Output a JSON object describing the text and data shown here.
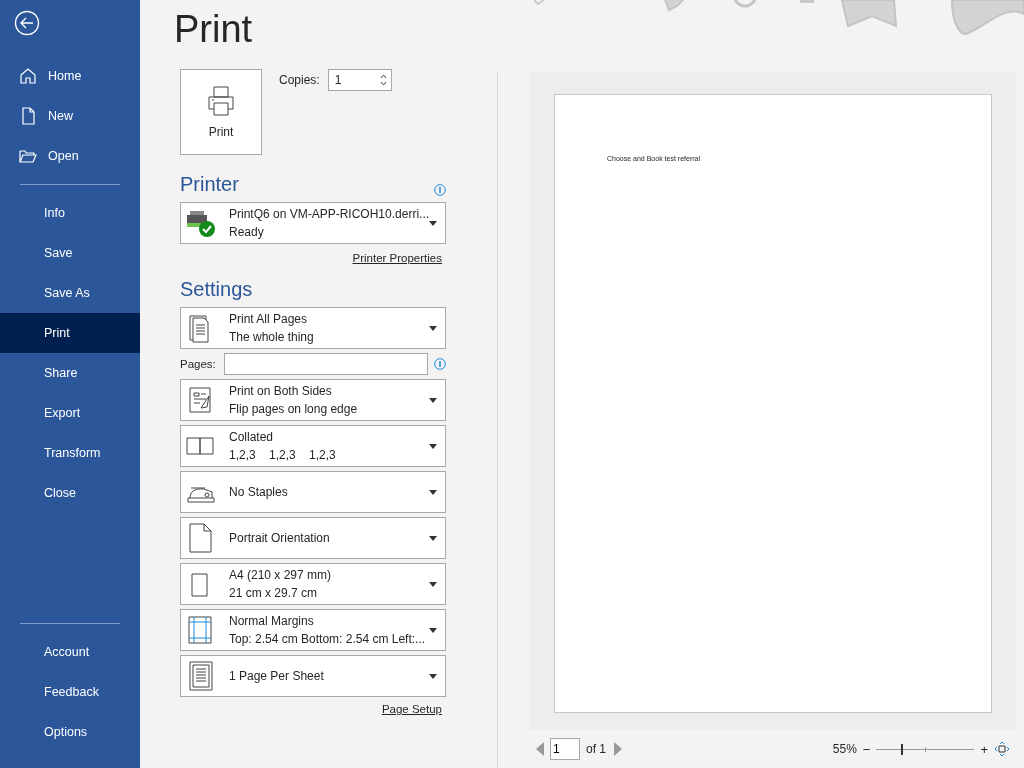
{
  "sidebar": {
    "top_items": [
      {
        "label": "Home",
        "selected": false
      },
      {
        "label": "New",
        "selected": false
      },
      {
        "label": "Open",
        "selected": false
      }
    ],
    "items": [
      {
        "label": "Info",
        "selected": false
      },
      {
        "label": "Save",
        "selected": false
      },
      {
        "label": "Save As",
        "selected": false
      },
      {
        "label": "Print",
        "selected": true
      },
      {
        "label": "Share",
        "selected": false
      },
      {
        "label": "Export",
        "selected": false
      },
      {
        "label": "Transform",
        "selected": false
      },
      {
        "label": "Close",
        "selected": false
      }
    ],
    "bottom_items": [
      {
        "label": "Account",
        "selected": false
      },
      {
        "label": "Feedback",
        "selected": false
      },
      {
        "label": "Options",
        "selected": false
      }
    ]
  },
  "title": "Print",
  "print_button": {
    "label": "Print"
  },
  "copies": {
    "label": "Copies:",
    "value": "1"
  },
  "printer": {
    "heading": "Printer",
    "name": "PrintQ6 on VM-APP-RICOH10.derri...",
    "status": "Ready",
    "properties_link": "Printer Properties"
  },
  "settings": {
    "heading": "Settings",
    "items": [
      {
        "kind": "pages",
        "title": "Print All Pages",
        "subtitle": "The whole thing"
      },
      {
        "kind": "field",
        "label": "Pages:"
      },
      {
        "kind": "duplex",
        "title": "Print on Both Sides",
        "subtitle": "Flip pages on long edge"
      },
      {
        "kind": "collate",
        "title": "Collated",
        "subtitle": "1,2,3    1,2,3    1,2,3"
      },
      {
        "kind": "staple",
        "title": "No Staples"
      },
      {
        "kind": "portrait",
        "title": "Portrait Orientation"
      },
      {
        "kind": "paper",
        "title": "A4 (210 x 297 mm)",
        "subtitle": "21 cm x 29.7 cm"
      },
      {
        "kind": "margins",
        "title": "Normal Margins",
        "subtitle": "Top: 2.54 cm Bottom: 2.54 cm Left:..."
      },
      {
        "kind": "persheet",
        "title": "1 Page Per Sheet"
      }
    ],
    "page_setup_link": "Page Setup"
  },
  "preview": {
    "page_text": "Choose and Book test referral",
    "page_number": "1",
    "page_count": "of 1",
    "zoom": {
      "reading": "55%",
      "minus": "−",
      "plus": "+",
      "level": 0.26
    }
  }
}
